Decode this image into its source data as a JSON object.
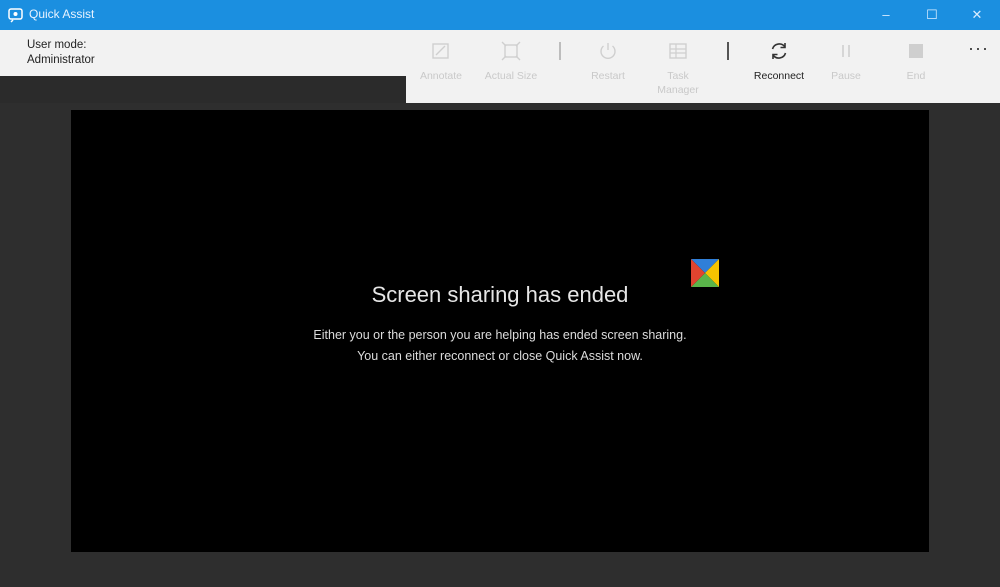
{
  "window": {
    "title": "Quick Assist",
    "controls": {
      "minimize": "–",
      "maximize": "☐",
      "close": "✕"
    }
  },
  "header": {
    "user_mode_label": "User mode:",
    "user_mode_value": "Administrator"
  },
  "toolbar": {
    "items": [
      {
        "label": "Annotate",
        "icon": "annotate-icon",
        "enabled": false
      },
      {
        "label": "Actual Size",
        "icon": "actual-size-icon",
        "enabled": false
      },
      {
        "label": "Restart",
        "icon": "restart-icon",
        "enabled": false
      },
      {
        "label": "Task Manager",
        "icon": "task-manager-icon",
        "enabled": false
      },
      {
        "label": "Reconnect",
        "icon": "reconnect-icon",
        "enabled": true
      },
      {
        "label": "Pause",
        "icon": "pause-icon",
        "enabled": false
      },
      {
        "label": "End",
        "icon": "end-icon",
        "enabled": false
      }
    ],
    "more": "···"
  },
  "screen": {
    "title": "Screen sharing has ended",
    "body_line1": "Either you or the person you are helping has ended screen sharing.",
    "body_line2": "You can either reconnect or close Quick Assist now."
  },
  "colors": {
    "titlebar": "#1b8fe0",
    "toolbar_bg": "#f2f2f2",
    "disabled_text": "#c9c9c9",
    "screen_bg": "#000000"
  }
}
